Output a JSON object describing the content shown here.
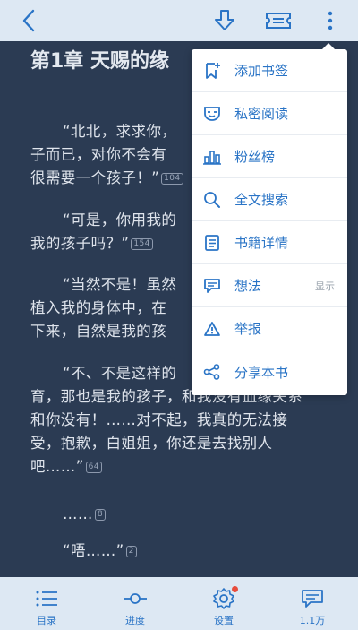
{
  "toolbar": {
    "back_icon": "back-arrow-icon",
    "download_icon": "download-icon",
    "ticket_icon": "ticket-icon",
    "more_icon": "more-vertical-icon"
  },
  "reader": {
    "chapter_title": "第1章 天赐的缘",
    "paragraphs": [
      {
        "lines": [
          "“北北，求求你，",
          "子而已，对你不会有",
          "很需要一个孩子！”"
        ],
        "badge": "104"
      },
      {
        "lines": [
          "“可是，你用我的",
          "我的孩子吗？”"
        ],
        "badge": "154"
      },
      {
        "lines": [
          "“当然不是！虽然",
          "植入我的身体中，在",
          "下来，自然是我的孩"
        ],
        "badge": ""
      },
      {
        "lines": [
          "“不、不是这样的",
          "育，那也是我的孩子，和我没有血缘关系",
          "和你没有！……对不起，我真的无法接",
          "受，抱歉，白姐姐，你还是去找别人",
          "吧……”"
        ],
        "badge": "64"
      },
      {
        "lines": [
          "……"
        ],
        "badge": "8"
      },
      {
        "lines": [
          "“唔……”"
        ],
        "badge": "2"
      }
    ]
  },
  "menu": {
    "items": [
      {
        "label": "添加书签",
        "icon": "bookmark-add-icon",
        "hint": ""
      },
      {
        "label": "私密阅读",
        "icon": "mask-icon",
        "hint": ""
      },
      {
        "label": "粉丝榜",
        "icon": "bar-chart-icon",
        "hint": ""
      },
      {
        "label": "全文搜索",
        "icon": "search-icon",
        "hint": ""
      },
      {
        "label": "书籍详情",
        "icon": "document-icon",
        "hint": ""
      },
      {
        "label": "想法",
        "icon": "comment-icon",
        "hint": "显示"
      },
      {
        "label": "举报",
        "icon": "warning-icon",
        "hint": ""
      },
      {
        "label": "分享本书",
        "icon": "share-icon",
        "hint": ""
      }
    ]
  },
  "bottom_tabs": [
    {
      "label": "目录",
      "icon": "list-icon"
    },
    {
      "label": "进度",
      "icon": "progress-slider-icon"
    },
    {
      "label": "设置",
      "icon": "gear-icon",
      "dot": true
    },
    {
      "label": "1.1万",
      "icon": "comment-bubble-icon"
    }
  ],
  "colors": {
    "accent": "#2a74c6",
    "bar": "#dde8f3",
    "page": "#2b3b53",
    "text": "#dfe4ec"
  }
}
